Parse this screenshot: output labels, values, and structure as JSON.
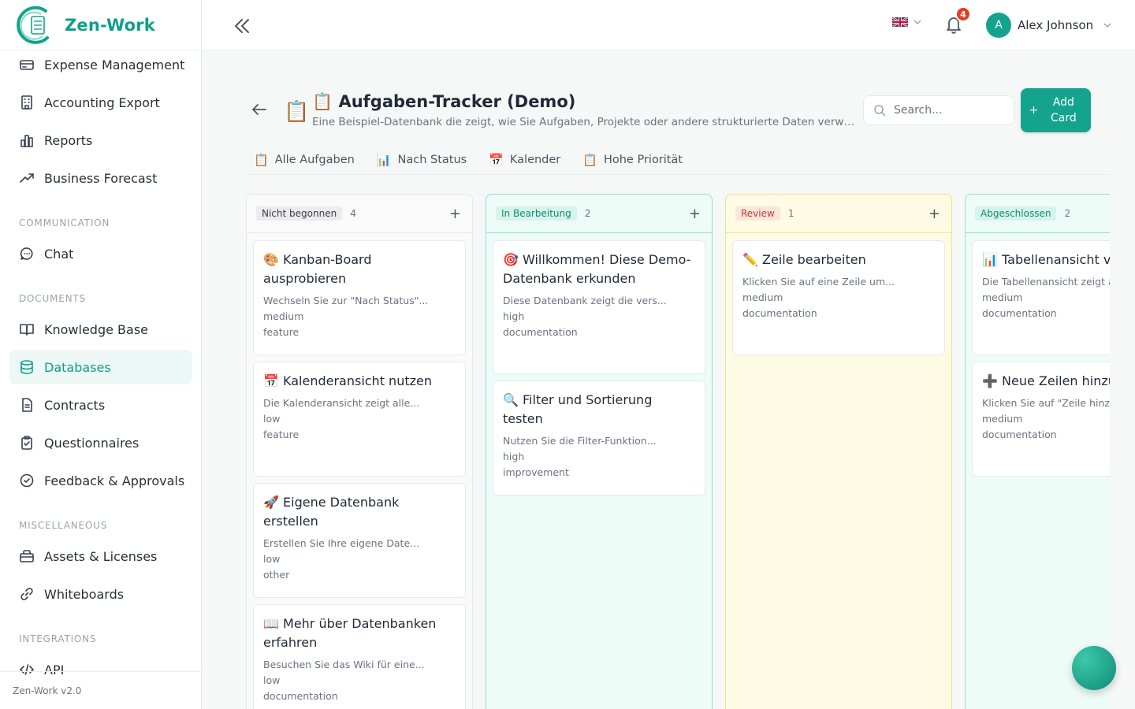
{
  "app": {
    "name": "Zen-Work",
    "version": "Zen-Work v2.0"
  },
  "sidebar": {
    "items": [
      {
        "label": "Expense Management",
        "icon": "wallet-icon"
      },
      {
        "label": "Accounting Export",
        "icon": "building-icon"
      },
      {
        "label": "Reports",
        "icon": "bar-chart-icon"
      },
      {
        "label": "Business Forecast",
        "icon": "trend-up-icon"
      }
    ],
    "sections": [
      {
        "title": "COMMUNICATION",
        "items": [
          {
            "label": "Chat",
            "icon": "chat-icon"
          }
        ]
      },
      {
        "title": "DOCUMENTS",
        "items": [
          {
            "label": "Knowledge Base",
            "icon": "book-icon"
          },
          {
            "label": "Databases",
            "icon": "database-icon",
            "active": true
          },
          {
            "label": "Contracts",
            "icon": "file-icon"
          },
          {
            "label": "Questionnaires",
            "icon": "clipboard-check-icon"
          },
          {
            "label": "Feedback & Approvals",
            "icon": "check-circle-icon"
          }
        ]
      },
      {
        "title": "MISCELLANEOUS",
        "items": [
          {
            "label": "Assets & Licenses",
            "icon": "briefcase-icon"
          },
          {
            "label": "Whiteboards",
            "icon": "link-icon"
          }
        ]
      },
      {
        "title": "INTEGRATIONS",
        "items": [
          {
            "label": "API",
            "icon": "code-icon"
          }
        ]
      }
    ]
  },
  "topbar": {
    "language": "uk-flag-icon",
    "notifications": "4",
    "user_initial": "A",
    "user_name": "Alex Johnson"
  },
  "page": {
    "icon": "📋",
    "title": "📋 Aufgaben-Tracker (Demo)",
    "subtitle": "Eine Beispiel-Datenbank die zeigt, wie Sie Aufgaben, Projekte oder andere strukturierte Daten verwalten können.",
    "search_placeholder": "Search...",
    "add_button": "Add Card"
  },
  "views": [
    {
      "icon": "📋",
      "label": "Alle Aufgaben"
    },
    {
      "icon": "📊",
      "label": "Nach Status"
    },
    {
      "icon": "📅",
      "label": "Kalender"
    },
    {
      "icon": "📋",
      "label": "Hohe Priorität"
    }
  ],
  "columns": [
    {
      "label": "Nicht begonnen",
      "count": "4",
      "colors": {
        "bg": "#fafafa",
        "border": "#e5e7eb",
        "pill_bg": "#ececec",
        "pill_fg": "#374151"
      },
      "cards": [
        {
          "title": "🎨 Kanban-Board ausprobieren",
          "desc": "Wechseln Sie zur \"Nach Status\"...",
          "priority": "medium",
          "type": "feature"
        },
        {
          "title": "📅 Kalenderansicht nutzen",
          "desc": "Die Kalenderansicht zeigt alle...",
          "priority": "low",
          "type": "feature"
        },
        {
          "title": "🚀 Eigene Datenbank erstellen",
          "desc": "Erstellen Sie Ihre eigene Date...",
          "priority": "low",
          "type": "other"
        },
        {
          "title": "📖 Mehr über Datenbanken erfahren",
          "desc": "Besuchen Sie das Wiki für eine...",
          "priority": "low",
          "type": "documentation"
        }
      ]
    },
    {
      "label": "In Bearbeitung",
      "count": "2",
      "colors": {
        "bg": "#eefcf7",
        "border": "#8fe3cf",
        "pill_bg": "#d6f5ea",
        "pill_fg": "#0f8a78"
      },
      "cards": [
        {
          "title": "🎯 Willkommen! Diese Demo-Datenbank erkunden",
          "desc": "Diese Datenbank zeigt die vers...",
          "priority": "high",
          "type": "documentation"
        },
        {
          "title": "🔍 Filter und Sortierung testen",
          "desc": "Nutzen Sie die Filter-Funktion...",
          "priority": "high",
          "type": "improvement"
        }
      ]
    },
    {
      "label": "Review",
      "count": "1",
      "colors": {
        "bg": "#fefbe4",
        "border": "#f3e08a",
        "pill_bg": "#fbe5dc",
        "pill_fg": "#b4452b"
      },
      "cards": [
        {
          "title": "✏️ Zeile bearbeiten",
          "desc": "Klicken Sie auf eine Zeile um...",
          "priority": "medium",
          "type": "documentation"
        }
      ]
    },
    {
      "label": "Abgeschlossen",
      "count": "2",
      "colors": {
        "bg": "#eefcf7",
        "border": "#8fe3cf",
        "pill_bg": "#d6f5ea",
        "pill_fg": "#0f8a78"
      },
      "cards": [
        {
          "title": "📊 Tabellenansicht verwenden",
          "desc": "Die Tabellenansicht zeigt alle...",
          "priority": "medium",
          "type": "documentation"
        },
        {
          "title": "➕ Neue Zeilen hinzufügen",
          "desc": "Klicken Sie auf \"Zeile hinzufügen\"...",
          "priority": "medium",
          "type": "documentation"
        }
      ]
    }
  ]
}
